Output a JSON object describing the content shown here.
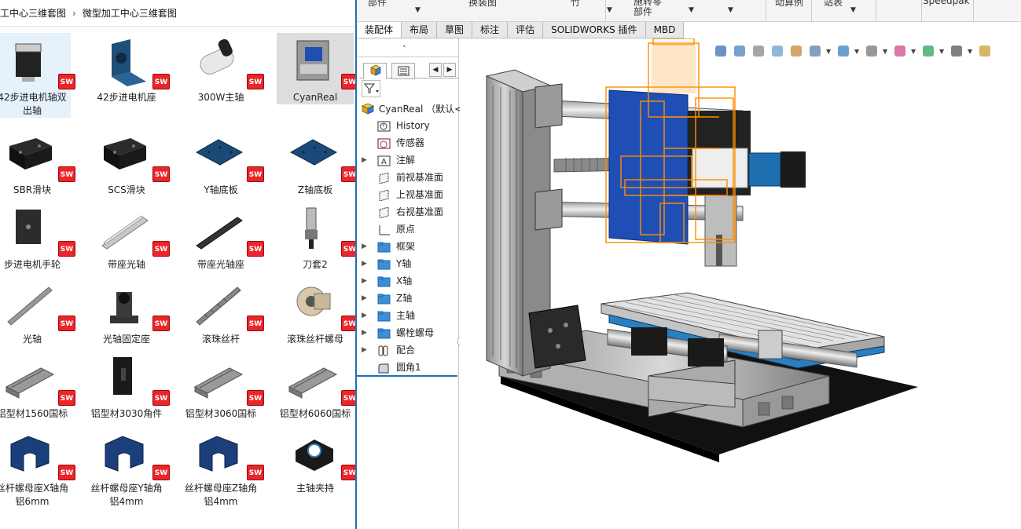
{
  "explorer": {
    "breadcrumb": [
      "工中心三维套图",
      "微型加工中心三维套图"
    ],
    "badge": "SW",
    "files": [
      {
        "label": "42步进电机轴双出轴",
        "icon": "stepper-motor-icon",
        "state": "selected"
      },
      {
        "label": "42步进电机座",
        "icon": "motor-mount-icon"
      },
      {
        "label": "300W主轴",
        "icon": "spindle-motor-icon"
      },
      {
        "label": "CyanReal",
        "icon": "cnc-assembly-icon",
        "state": "highlight"
      },
      {
        "label": "SBR滑块",
        "icon": "slider-block-icon"
      },
      {
        "label": "SCS滑块",
        "icon": "slider-block-icon"
      },
      {
        "label": "Y轴底板",
        "icon": "plate-icon"
      },
      {
        "label": "Z轴底板",
        "icon": "plate-icon"
      },
      {
        "label": "步进电机手轮",
        "icon": "handwheel-icon"
      },
      {
        "label": "带座光轴",
        "icon": "supported-rail-icon"
      },
      {
        "label": "带座光轴座",
        "icon": "rail-base-icon"
      },
      {
        "label": "刀套2",
        "icon": "tool-holder-icon"
      },
      {
        "label": "光轴",
        "icon": "shaft-icon"
      },
      {
        "label": "光轴固定座",
        "icon": "shaft-support-icon"
      },
      {
        "label": "滚珠丝杆",
        "icon": "ballscrew-icon"
      },
      {
        "label": "滚珠丝杆螺母",
        "icon": "ballscrew-nut-icon"
      },
      {
        "label": "铝型材1560国标",
        "icon": "aluminum-profile-icon"
      },
      {
        "label": "铝型材3030角件",
        "icon": "corner-bracket-icon"
      },
      {
        "label": "铝型材3060国标",
        "icon": "aluminum-profile-icon"
      },
      {
        "label": "铝型材6060国标",
        "icon": "aluminum-profile-icon"
      },
      {
        "label": "丝杆螺母座X轴角铝6mm",
        "icon": "nut-seat-icon"
      },
      {
        "label": "丝杆螺母座Y轴角铝4mm",
        "icon": "nut-seat-icon"
      },
      {
        "label": "丝杆螺母座Z轴角铝4mm",
        "icon": "nut-seat-icon"
      },
      {
        "label": "主轴夹持",
        "icon": "spindle-clamp-icon"
      }
    ]
  },
  "sw": {
    "toolbar_cut": [
      "部件",
      "换装图",
      "竹",
      "施转零部件",
      "动算例",
      "站表",
      "Speedpak"
    ],
    "tabs": [
      "装配体",
      "布局",
      "草图",
      "标注",
      "评估",
      "SOLIDWORKS 插件",
      "MBD"
    ],
    "active_tab": "装配体",
    "tree": {
      "root": "CyanReal （默认<默",
      "nodes": [
        {
          "label": "History",
          "icon": "history-icon",
          "arrow": false
        },
        {
          "label": "传感器",
          "icon": "sensor-icon",
          "arrow": false
        },
        {
          "label": "注解",
          "icon": "annotation-icon",
          "arrow": true
        },
        {
          "label": "前视基准面",
          "icon": "plane-icon",
          "arrow": false
        },
        {
          "label": "上视基准面",
          "icon": "plane-icon",
          "arrow": false
        },
        {
          "label": "右视基准面",
          "icon": "plane-icon",
          "arrow": false
        },
        {
          "label": "原点",
          "icon": "origin-icon",
          "arrow": false
        },
        {
          "label": "框架",
          "icon": "folder-icon",
          "arrow": true
        },
        {
          "label": "Y轴",
          "icon": "folder-icon",
          "arrow": true
        },
        {
          "label": "X轴",
          "icon": "folder-icon",
          "arrow": true
        },
        {
          "label": "Z轴",
          "icon": "folder-icon",
          "arrow": true
        },
        {
          "label": "主轴",
          "icon": "folder-icon",
          "arrow": true
        },
        {
          "label": "螺栓螺母",
          "icon": "folder-icon",
          "arrow": true
        },
        {
          "label": "配合",
          "icon": "mate-icon",
          "arrow": true
        },
        {
          "label": "圆角1",
          "icon": "fillet-icon",
          "arrow": false
        }
      ]
    },
    "hud_icons": [
      "zoom-to-fit-icon",
      "zoom-area-icon",
      "previous-view-icon",
      "section-view-icon",
      "dynamic-annotation-icon",
      "view-orientation-icon",
      "display-style-icon",
      "hide-show-icon",
      "edit-appearance-icon",
      "scene-icon",
      "display-settings-icon",
      "rotate-icon"
    ],
    "colors": {
      "accent": "#1f6fb5",
      "folder": "#3a8fd8",
      "selection": "#ff8c00",
      "sw_red": "#e8262c"
    }
  }
}
